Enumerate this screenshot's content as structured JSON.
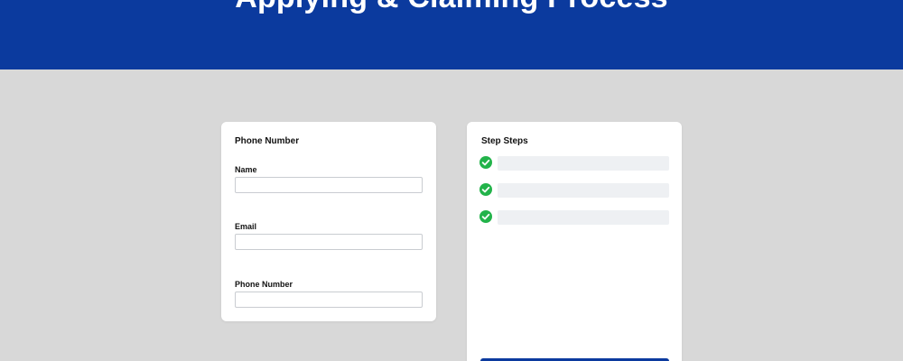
{
  "header": {
    "title": "Applying & Claiming Process"
  },
  "form_card": {
    "heading": "Phone Number",
    "fields": [
      {
        "label": "Name",
        "value": "",
        "placeholder": ""
      },
      {
        "label": "Email",
        "value": "",
        "placeholder": ""
      },
      {
        "label": "Phone Number",
        "value": "",
        "placeholder": ""
      }
    ]
  },
  "steps_card": {
    "heading": "Step Steps",
    "steps": [
      {
        "status": "complete",
        "icon": "check-circle-icon"
      },
      {
        "status": "complete",
        "icon": "check-circle-icon"
      },
      {
        "status": "complete",
        "icon": "check-circle-icon"
      }
    ],
    "submit_label": ""
  },
  "colors": {
    "brand_blue": "#0b3a9e",
    "background": "#d8d8d8",
    "success_green": "#22b34a",
    "placeholder_bar": "#eef0f3"
  }
}
